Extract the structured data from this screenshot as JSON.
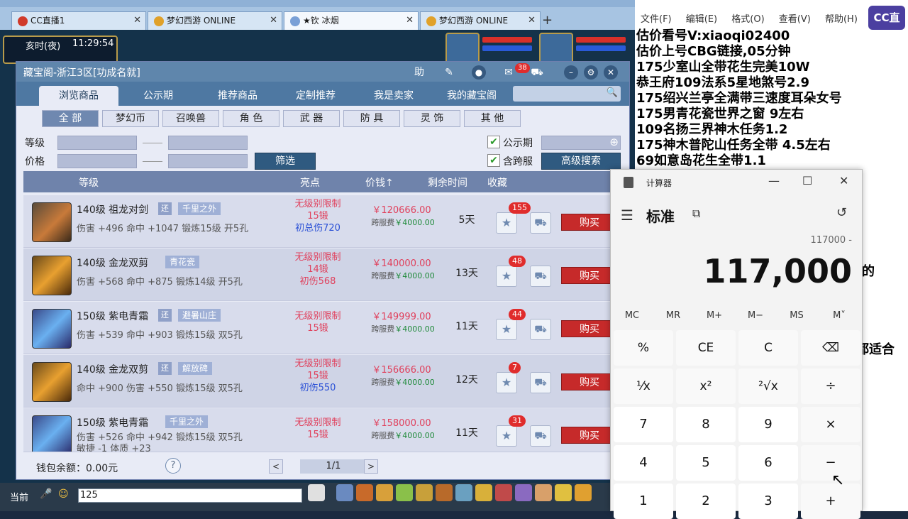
{
  "browser": {
    "tabs": [
      {
        "label": "CC直播1",
        "active": false
      },
      {
        "label": "梦幻西游 ONLINE",
        "active": false
      },
      {
        "label": "★钦 冰烟",
        "active": true
      },
      {
        "label": "梦幻西游 ONLINE",
        "active": false
      }
    ],
    "add_tab": "+"
  },
  "hud": {
    "period": "亥时(夜)",
    "time": "11:29:54"
  },
  "window": {
    "title": "藏宝阁-浙江3区[功成名就]",
    "title_buttons": [
      "助",
      "38"
    ],
    "msg_count": "38",
    "nav": [
      "浏览商品",
      "公示期",
      "推荐商品",
      "定制推荐",
      "我是卖家",
      "我的藏宝阁"
    ],
    "categories": [
      "全 部",
      "梦幻币",
      "召唤兽",
      "角 色",
      "武 器",
      "防 具",
      "灵 饰",
      "其 他"
    ],
    "filters": {
      "level_label": "等级",
      "price_label": "价格",
      "filter_button": "筛选",
      "check1": "公示期",
      "check2": "含跨服",
      "advanced": "高级搜索"
    },
    "table_headers": [
      "等级",
      "亮点",
      "价钱↑",
      "剩余时间",
      "收藏"
    ],
    "rows": [
      {
        "level_name": "140级 祖龙对剑",
        "tag1": "还",
        "tag2": "千里之外",
        "stats": "伤害 +496 命中 +1047 锻炼15级 开5孔",
        "stats2": "",
        "hl1": "无级别限制",
        "hl2": "15锻",
        "hl3": "初总伤720",
        "hl3_color": "blue",
        "price": "￥120666.00",
        "fee_label": "跨服费",
        "fee": "￥4000.00",
        "remain": "5天",
        "fav_count": "155",
        "buy": "购买"
      },
      {
        "level_name": "140级 金龙双剪",
        "tag1": "",
        "tag2": "青花瓷",
        "stats": "伤害 +568 命中 +875 锻炼14级 开5孔",
        "stats2": "",
        "hl1": "无级别限制",
        "hl2": "14锻",
        "hl3": "初伤568",
        "hl3_color": "red",
        "price": "￥140000.00",
        "fee_label": "跨服费",
        "fee": "￥4000.00",
        "remain": "13天",
        "fav_count": "48",
        "buy": "购买"
      },
      {
        "level_name": "150级 紫电青霜",
        "tag1": "还",
        "tag2": "避暑山庄",
        "stats": "伤害 +539 命中 +903 锻炼15级 双5孔",
        "stats2": "",
        "hl1": "无级别限制",
        "hl2": "15锻",
        "hl3": "",
        "hl3_color": "blue",
        "price": "￥149999.00",
        "fee_label": "跨服费",
        "fee": "￥4000.00",
        "remain": "11天",
        "fav_count": "44",
        "buy": "购买"
      },
      {
        "level_name": "140级 金龙双剪",
        "tag1": "还",
        "tag2": "解放碑",
        "stats": "命中 +900 伤害 +550 锻炼15级 双5孔",
        "stats2": "",
        "hl1": "无级别限制",
        "hl2": "15锻",
        "hl3": "初伤550",
        "hl3_color": "blue",
        "price": "￥156666.00",
        "fee_label": "跨服费",
        "fee": "￥4000.00",
        "remain": "12天",
        "fav_count": "7",
        "buy": "购买"
      },
      {
        "level_name": "150级 紫电青霜",
        "tag1": "还",
        "tag2": "千里之外",
        "stats": "伤害 +526 命中 +942 锻炼15级 双5孔",
        "stats2": "敏捷 -1 体质 +23",
        "hl1": "无级别限制",
        "hl2": "15锻",
        "hl3": "",
        "hl3_color": "blue",
        "price": "￥158000.00",
        "fee_label": "跨服费",
        "fee": "￥4000.00",
        "remain": "11天",
        "fav_count": "31",
        "buy": "购买"
      }
    ],
    "footer": {
      "wallet": "钱包余额：0.00元",
      "help": "?",
      "page": "1/1",
      "prev": "<",
      "next": ">"
    }
  },
  "chat": {
    "label": "当前",
    "input": "125"
  },
  "notepad": {
    "menu": [
      "文件(F)",
      "编辑(E)",
      "格式(O)",
      "查看(V)",
      "帮助(H)"
    ],
    "lines": [
      "估价看号V:xiaoqi02400",
      "估价上号CBG链接,05分钟",
      "175少室山全带花生完美10W",
      "恭王府109法系5星地煞号2.9",
      "175绍兴兰亭全满带三速度耳朵女号",
      "175男青花瓷世界之窗  9左右",
      "109名扬三界神木任务1.2",
      "175神木普陀山任务全带 4.5左右",
      "69如意岛花生全带1.1"
    ],
    "partial_right": [
      "的",
      "都适合"
    ],
    "logo": "CC直播"
  },
  "calculator": {
    "title": "计算器",
    "mode": "标准",
    "expression": "117000 -",
    "display": "117,000",
    "memory": [
      "MC",
      "MR",
      "M+",
      "M−",
      "MS",
      "M˅"
    ],
    "keys": [
      [
        "%",
        "CE",
        "C",
        "⌫"
      ],
      [
        "¹⁄x",
        "x²",
        "²√x",
        "÷"
      ],
      [
        "7",
        "8",
        "9",
        "×"
      ],
      [
        "4",
        "5",
        "6",
        "−"
      ],
      [
        "1",
        "2",
        "3",
        "+"
      ]
    ]
  }
}
